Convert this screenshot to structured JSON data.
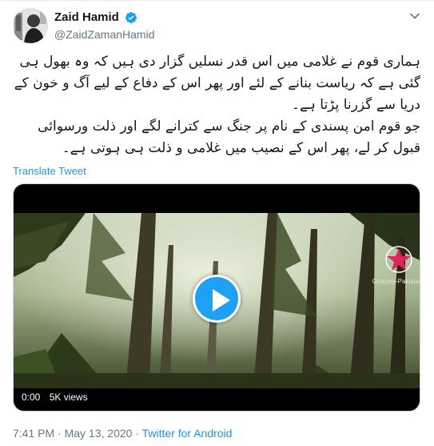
{
  "author": {
    "display_name": "Zaid Hamid",
    "handle": "@ZaidZamanHamid",
    "verified": true,
    "avatar_icon": "profile-photo"
  },
  "tweet": {
    "lines": [
      "ہماری قوم نے غلامی میں اس قدر نسلیں گزار دی ہیں کہ وہ بھول ہی گئی ہے کہ ریاست بنانے کے لئے اور پھر اس کے دفاع کے لیے آگ و خون کے دریا سے گزرنا پڑتا ہے۔",
      "جو قوم امن پسندی کے نام پر جنگ سے کترانے لگے اور ذلت ورسوائی قبول کر لے، پھر اس کے نصیب میں غلامی و ذلت ہی ہوتی ہے۔"
    ],
    "translate_label": "Translate Tweet"
  },
  "video": {
    "time": "0:00",
    "views": "5K views",
    "watermark": "Ghazwa-Pakistan",
    "accent_color": "#1da1f2"
  },
  "footer": {
    "time": "7:41 PM",
    "separator": "·",
    "date": "May 13, 2020",
    "source": "Twitter for Android"
  },
  "icons": {
    "verified": "verified-badge-icon",
    "menu": "chevron-down-icon",
    "play": "play-icon",
    "logo": "star-logo-icon"
  }
}
